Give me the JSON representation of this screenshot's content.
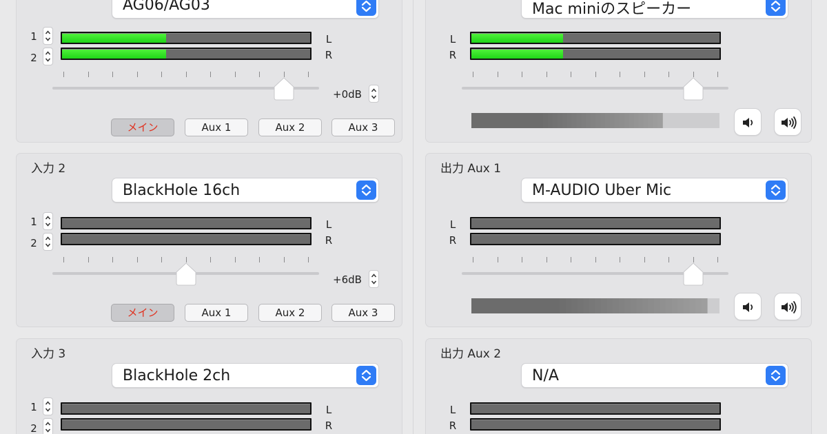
{
  "left_panels": [
    {
      "title": "",
      "device": "AG06/AG03",
      "channels": [
        "1",
        "2"
      ],
      "lr": [
        "L",
        "R"
      ],
      "meter_levels": [
        0.42,
        0.42
      ],
      "gain": "+0dB",
      "slider_level": 0.9,
      "routes": [
        "メイン",
        "Aux 1",
        "Aux 2",
        "Aux 3"
      ]
    },
    {
      "title": "入力 2",
      "device": "BlackHole 16ch",
      "channels": [
        "1",
        "2"
      ],
      "lr": [
        "L",
        "R"
      ],
      "meter_levels": [
        0,
        0
      ],
      "gain": "+6dB",
      "slider_level": 0.5,
      "routes": [
        "メイン",
        "Aux 1",
        "Aux 2",
        "Aux 3"
      ]
    },
    {
      "title": "入力 3",
      "device": "BlackHole 2ch",
      "channels": [
        "1",
        "2"
      ],
      "lr": [
        "L",
        "R"
      ],
      "meter_levels": [
        0,
        0
      ]
    }
  ],
  "right_panels": [
    {
      "title": "",
      "device": "Mac miniのスピーカー",
      "lr": [
        "L",
        "R"
      ],
      "meter_levels": [
        0.37,
        0.37
      ],
      "slider_level": 0.9,
      "output_level": 0.77
    },
    {
      "title": "出力 Aux 1",
      "device": "M-AUDIO Uber Mic",
      "lr": [
        "L",
        "R"
      ],
      "meter_levels": [
        0,
        0
      ],
      "slider_level": 0.9,
      "output_level": 0.95
    },
    {
      "title": "出力 Aux 2",
      "device": "N/A",
      "lr": [
        "L",
        "R"
      ],
      "meter_levels": [
        0,
        0
      ]
    }
  ],
  "icons": {
    "select": "chevron-updown-icon",
    "stepper": "stepper-icon",
    "mute": "speaker-low-icon",
    "loud": "speaker-high-icon"
  },
  "colors": {
    "accent": "#2f7cf6",
    "meter_green": "#2ee526",
    "active_route_text": "#e0301e"
  }
}
